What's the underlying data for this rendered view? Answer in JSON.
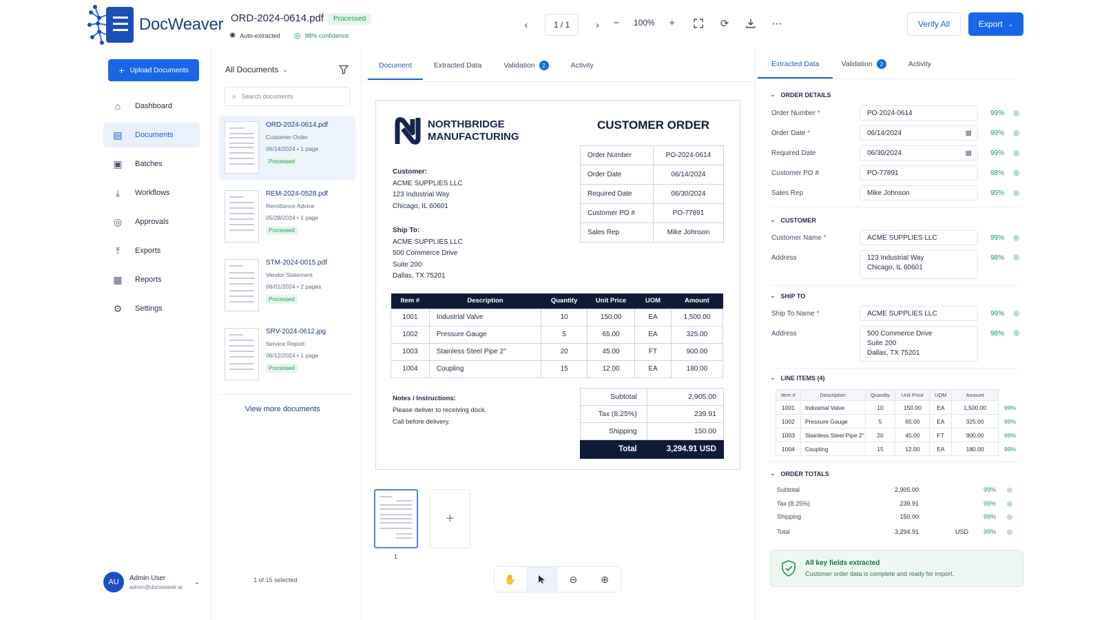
{
  "app": {
    "name": "DocWeaver"
  },
  "header": {
    "file_title": "ORD-2024-0614.pdf",
    "status": "Processed",
    "auto_label": "Auto-extracted",
    "confidence": "98% confidence",
    "page_indicator": "1 / 1",
    "zoom": "100%",
    "verify_label": "Verify All",
    "export_label": "Export"
  },
  "sidebar": {
    "upload_label": "Upload Documents",
    "items": [
      {
        "label": "Dashboard",
        "icon": "home-icon"
      },
      {
        "label": "Documents",
        "icon": "document-icon"
      },
      {
        "label": "Batches",
        "icon": "clipboard-icon"
      },
      {
        "label": "Workflows",
        "icon": "download-icon"
      },
      {
        "label": "Approvals",
        "icon": "check-circle-icon"
      },
      {
        "label": "Exports",
        "icon": "export-icon"
      },
      {
        "label": "Reports",
        "icon": "report-icon"
      },
      {
        "label": "Settings",
        "icon": "gear-icon"
      }
    ],
    "user": {
      "initials": "AU",
      "name": "Admin User",
      "email": "admin@docweaver.ai"
    }
  },
  "doclist": {
    "filter_label": "All Documents",
    "search_placeholder": "Search documents",
    "documents": [
      {
        "name": "ORD-2024-0614.pdf",
        "type": "Customer Order",
        "date": "06/14/2024",
        "pages": "1 page",
        "status": "Processed"
      },
      {
        "name": "REM-2024-0528.pdf",
        "type": "Remittance Advice",
        "date": "05/28/2024",
        "pages": "1 page",
        "status": "Processed"
      },
      {
        "name": "STM-2024-0015.pdf",
        "type": "Vendor Statement",
        "date": "06/01/2024",
        "pages": "2 pages",
        "status": "Processed"
      },
      {
        "name": "SRV-2024-0612.jpg",
        "type": "Service Report",
        "date": "06/12/2024",
        "pages": "1 page",
        "status": "Processed"
      }
    ],
    "view_more": "View more documents",
    "selected": "1 of 15 selected"
  },
  "center_tabs": {
    "document": "Document",
    "extracted": "Extracted Data",
    "validation": "Validation",
    "validation_count": "2",
    "activity": "Activity"
  },
  "preview": {
    "company_line1": "NORTHBRIDGE",
    "company_line2": "MANUFACTURING",
    "title": "CUSTOMER ORDER",
    "info": [
      {
        "k": "Order Number",
        "v": "PO-2024-0614"
      },
      {
        "k": "Order Date",
        "v": "06/14/2024"
      },
      {
        "k": "Required Date",
        "v": "06/30/2024"
      },
      {
        "k": "Customer PO #",
        "v": "PO-77891"
      },
      {
        "k": "Sales Rep",
        "v": "Mike Johnson"
      }
    ],
    "customer_label": "Customer:",
    "customer_lines": [
      "ACME SUPPLIES LLC",
      "123 Industrial Way",
      "Chicago, IL 60601"
    ],
    "shipto_label": "Ship To:",
    "shipto_lines": [
      "ACME SUPPLIES LLC",
      "500 Commerce Drive",
      "Suite 200",
      "Dallas, TX 75201"
    ],
    "columns": [
      "Item #",
      "Description",
      "Quantity",
      "Unit Price",
      "UOM",
      "Amount"
    ],
    "items": [
      [
        "1001",
        "Industrial Valve",
        "10",
        "150.00",
        "EA",
        "1,500.00"
      ],
      [
        "1002",
        "Pressure Gauge",
        "5",
        "65.00",
        "EA",
        "325.00"
      ],
      [
        "1003",
        "Stainless Steel Pipe 2\"",
        "20",
        "45.00",
        "FT",
        "900.00"
      ],
      [
        "1004",
        "Coupling",
        "15",
        "12.00",
        "EA",
        "180.00"
      ]
    ],
    "notes_label": "Notes / Instructions:",
    "notes_lines": [
      "Please deliver to receiving dock.",
      "Call before delivery."
    ],
    "totals": [
      {
        "k": "Subtotal",
        "v": "2,905.00"
      },
      {
        "k": "Tax (8.25%)",
        "v": "239.91"
      },
      {
        "k": "Shipping",
        "v": "150.00"
      }
    ],
    "total_label": "Total",
    "total_value": "3,294.91 USD",
    "page_number": "1",
    "add_page": "+"
  },
  "right": {
    "tabs": {
      "extracted": "Extracted Data",
      "validation": "Validation",
      "validation_count": "2",
      "activity": "Activity"
    },
    "order_details_title": "ORDER DETAILS",
    "order_fields": [
      {
        "label": "Order Number",
        "required": true,
        "value": "PO-2024-0614",
        "pct": "99%"
      },
      {
        "label": "Order Date",
        "required": true,
        "value": "06/14/2024",
        "pct": "99%",
        "calendar": true
      },
      {
        "label": "Required Date",
        "required": false,
        "value": "06/30/2024",
        "pct": "99%",
        "calendar": true
      },
      {
        "label": "Customer PO #",
        "required": false,
        "value": "PO-77891",
        "pct": "98%"
      },
      {
        "label": "Sales Rep",
        "required": false,
        "value": "Mike Johnson",
        "pct": "95%"
      }
    ],
    "customer_title": "CUSTOMER",
    "customer_name_label": "Customer Name",
    "customer_name": "ACME SUPPLIES LLC",
    "customer_name_pct": "99%",
    "customer_addr_label": "Address",
    "customer_addr_1": "123 Industrial Way",
    "customer_addr_2": "Chicago, IL 60601",
    "customer_addr_pct": "98%",
    "shipto_title": "SHIP TO",
    "shipto_name_label": "Ship To Name",
    "shipto_name": "ACME SUPPLIES LLC",
    "shipto_name_pct": "99%",
    "shipto_addr_label": "Address",
    "shipto_addr_1": "500 Commerce Drive",
    "shipto_addr_2": "Suite 200",
    "shipto_addr_3": "Dallas, TX 75201",
    "shipto_addr_pct": "98%",
    "line_items_title": "LINE ITEMS (4)",
    "line_pcts": [
      "99%",
      "99%",
      "99%",
      "99%"
    ],
    "order_totals_title": "ORDER TOTALS",
    "totals": [
      {
        "k": "Subtotal",
        "v": "2,905.00",
        "u": "",
        "p": "99%"
      },
      {
        "k": "Tax (8.25%)",
        "v": "239.91",
        "u": "",
        "p": "99%"
      },
      {
        "k": "Shipping",
        "v": "150.00",
        "u": "",
        "p": "99%"
      },
      {
        "k": "Total",
        "v": "3,294.91",
        "u": "USD",
        "p": "99%"
      }
    ],
    "ok_title": "All key fields extracted",
    "ok_subtitle": "Customer order data is complete and ready for import."
  },
  "colors": {
    "primary": "#1967e8",
    "navy": "#0f1b36",
    "success": "#21935a"
  }
}
